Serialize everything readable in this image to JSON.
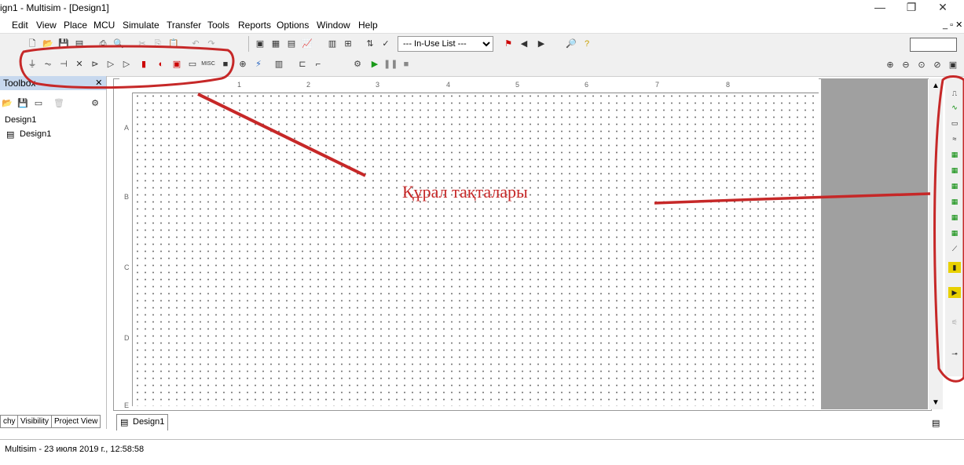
{
  "window": {
    "title": "ign1 - Multisim - [Design1]",
    "controls": {
      "minimize": "—",
      "restore": "❐",
      "close": "✕"
    }
  },
  "menu": {
    "items": [
      "Edit",
      "View",
      "Place",
      "MCU",
      "Simulate",
      "Transfer",
      "Tools",
      "Reports",
      "Options",
      "Window",
      "Help"
    ]
  },
  "toolbar": {
    "in_use_list": "--- In-Use List ---"
  },
  "toolbox": {
    "title": "Toolbox",
    "tree_root": "Design1",
    "tree_child": "Design1"
  },
  "left_tabs": [
    "chy",
    "Visibility",
    "Project View"
  ],
  "canvas": {
    "ruler_numbers": [
      "1",
      "2",
      "3",
      "4",
      "5",
      "6",
      "7",
      "8"
    ],
    "row_labels": [
      "A",
      "B",
      "C",
      "D",
      "E"
    ],
    "design_tab": "Design1"
  },
  "status": {
    "text": "Multisim  -  23 июля 2019 г., 12:58:58"
  },
  "annotation": {
    "text": "Құрал тақталары",
    "color": "#c62828"
  },
  "colors": {
    "toolbox_header": "#c7d8ee",
    "canvas_margin": "#a0a0a0"
  }
}
